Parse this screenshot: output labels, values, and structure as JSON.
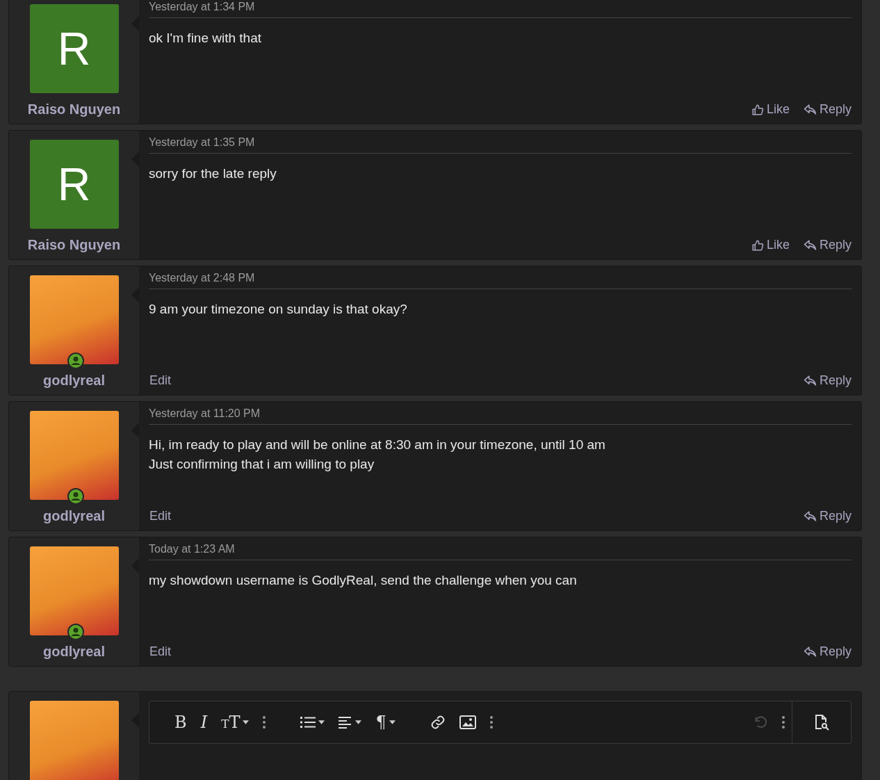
{
  "posts": [
    {
      "author": "Raiso Nguyen",
      "avatar": {
        "kind": "letter",
        "letter": "R",
        "color": "#3d7a26"
      },
      "online": false,
      "date": "Yesterday at 1:34 PM",
      "lines": [
        "ok I'm fine with that"
      ],
      "like": "Like",
      "reply": "Reply"
    },
    {
      "author": "Raiso Nguyen",
      "avatar": {
        "kind": "letter",
        "letter": "R",
        "color": "#3d7a26"
      },
      "online": false,
      "date": "Yesterday at 1:35 PM",
      "lines": [
        "sorry for the late reply"
      ],
      "like": "Like",
      "reply": "Reply"
    },
    {
      "author": "godlyreal",
      "avatar": {
        "kind": "image"
      },
      "online": true,
      "date": "Yesterday at 2:48 PM",
      "lines": [
        "9 am your timezone on sunday is that okay?"
      ],
      "edit": "Edit",
      "reply": "Reply"
    },
    {
      "author": "godlyreal",
      "avatar": {
        "kind": "image"
      },
      "online": true,
      "date": "Yesterday at 11:20 PM",
      "lines": [
        "Hi, im ready to play and will be online at 8:30 am in your timezone, until 10 am",
        "Just confirming that i am willing to play"
      ],
      "edit": "Edit",
      "reply": "Reply"
    },
    {
      "author": "godlyreal",
      "avatar": {
        "kind": "image"
      },
      "online": true,
      "date": "Today at 1:23 AM",
      "lines": [
        "my showdown username is GodlyReal, send the challenge when you can"
      ],
      "edit": "Edit",
      "reply": "Reply"
    }
  ],
  "composer": {
    "avatar": {
      "kind": "image"
    },
    "toolbar": [
      {
        "kind": "bold",
        "label": "B",
        "disabled": false
      },
      {
        "kind": "italic",
        "label": "I",
        "disabled": false
      },
      {
        "kind": "size",
        "label": "TT",
        "disabled": false
      },
      {
        "kind": "more",
        "disabled": false
      },
      {
        "kind": "gap"
      },
      {
        "kind": "list",
        "disabled": false
      },
      {
        "kind": "align",
        "disabled": false
      },
      {
        "kind": "paragraph",
        "label": "¶",
        "disabled": false
      },
      {
        "kind": "gap"
      },
      {
        "kind": "link",
        "disabled": false
      },
      {
        "kind": "image",
        "disabled": false
      },
      {
        "kind": "more",
        "disabled": false
      },
      {
        "kind": "spacer"
      },
      {
        "kind": "undo",
        "disabled": true
      },
      {
        "kind": "more",
        "disabled": false
      },
      {
        "kind": "preview",
        "disabled": false
      }
    ]
  }
}
